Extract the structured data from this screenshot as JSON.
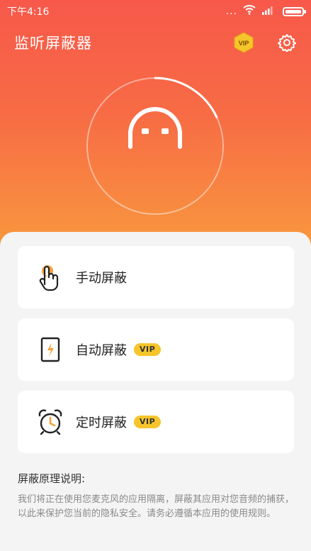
{
  "status_bar": {
    "time": "下午4:16",
    "more": "...",
    "battery_level": 1.0
  },
  "header": {
    "title": "监听屏蔽器",
    "vip_badge": "VIP",
    "settings_icon": "gear-icon"
  },
  "shield_status": {
    "icon": "robot-face-icon",
    "progress_arc_fraction": 0.18
  },
  "options": [
    {
      "label": "手动屏蔽",
      "icon": "hand-tap-icon",
      "vip": null
    },
    {
      "label": "自动屏蔽",
      "icon": "auto-lightning-icon",
      "vip": "VIP"
    },
    {
      "label": "定时屏蔽",
      "icon": "alarm-clock-icon",
      "vip": "VIP"
    }
  ],
  "explanation": {
    "title": "屏蔽原理说明:",
    "body": "我们将正在使用您麦克风的应用隔离，屏蔽其应用对您音频的捕获，以此来保护您当前的隐私安全。请务必遵循本应用的使用规则。"
  },
  "colors": {
    "gradient_top": "#f7584a",
    "gradient_bottom": "#f99a3e",
    "vip_yellow": "#f6c52a",
    "icon_orange": "#f7a13a"
  }
}
